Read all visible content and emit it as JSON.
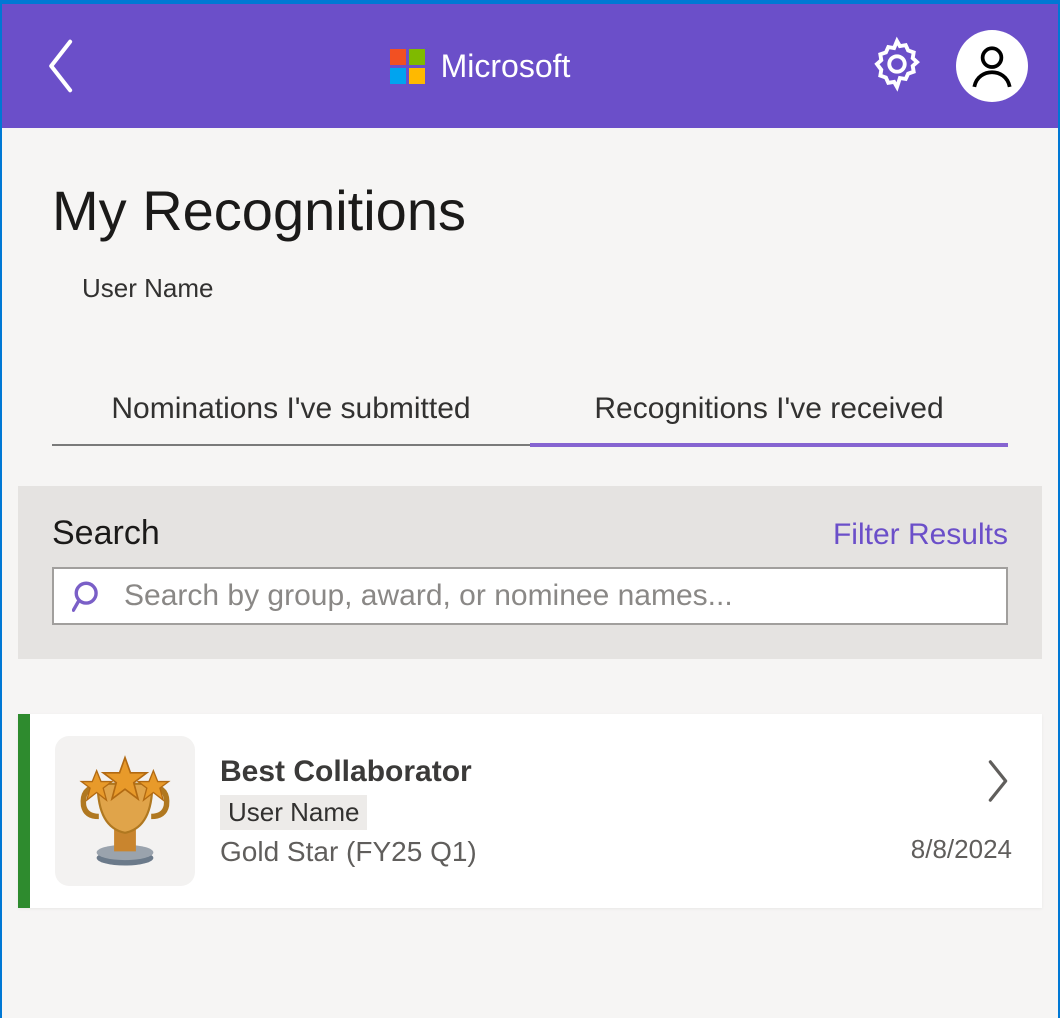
{
  "header": {
    "brand": "Microsoft"
  },
  "page": {
    "title": "My Recognitions",
    "subtitle": "User Name"
  },
  "tabs": [
    {
      "label": "Nominations I've submitted",
      "active": false
    },
    {
      "label": "Recognitions I've received",
      "active": true
    }
  ],
  "search": {
    "label": "Search",
    "filter_label": "Filter Results",
    "placeholder": "Search by group, award, or nominee names..."
  },
  "results": [
    {
      "title": "Best Collaborator",
      "user": "User Name",
      "subtitle": "Gold Star (FY25 Q1)",
      "date": "8/8/2024",
      "accent": "#2e8b2e"
    }
  ]
}
